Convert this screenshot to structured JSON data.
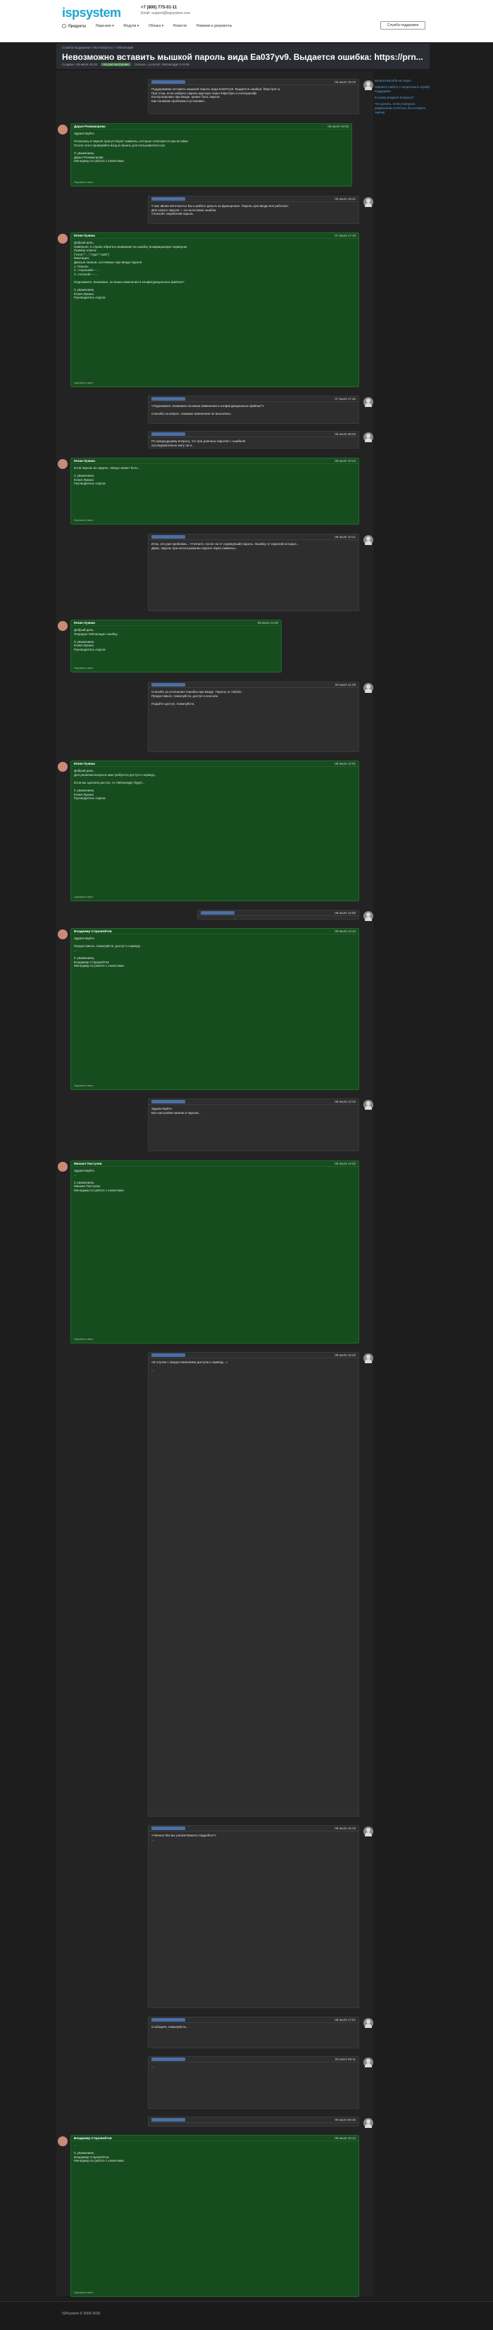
{
  "header": {
    "logo": "ispsystem",
    "phone": "+7 (800) 775-01-11",
    "support_email": "Email: support@ispsystem.com",
    "help_button": "Служба поддержки",
    "nav": [
      "Продукты",
      "Лицензии ▾",
      "Модули ▾",
      "Облака ▾",
      "Новости",
      "Новинки и документы"
    ]
  },
  "breadcrumb": "Служба поддержки > Все вопросы > VMmanager",
  "topic": {
    "title": "Невозможно вставить мышкой пароль вида Ea037yv9. Выдается ошибка: https://prn...",
    "created": "Создано: 06 июля 18:19",
    "status": "На рассмотрении",
    "meta_tail": "Связан с услугой: VMmanager 5 KVM"
  },
  "sidebar": {
    "items": [
      "Вопрос/жалоба на отдел",
      "Оцените работу с вопросом в службу поддержки",
      "В каком разделе вопроса?",
      "Что делать, если у вопроса разрешение хотелось бы оставить оценку"
    ]
  },
  "posts": [
    {
      "kind": "user",
      "name": "",
      "date": "06 июля 18:19",
      "body": "Поддерживаю вставить мышкой пароль вида Ea037yv9. Выдается ошибка: https://prn.a\nПри этом, если набрать пароль вручную через https://prn.a.ru/vmpaneljk\nКонтролировал при вводе, может быть пароль\nКак понимаю проблема в установке...",
      "foot": ""
    },
    {
      "kind": "staff",
      "name": "Дарья Рохмакорова",
      "date": "06 июля 19:03",
      "body": "Здравствуйте.\n\nПоскольку в пароле присутствуют символы, которые отличаются при вставке.\nПосле этого проверяйте вход в панель для пользователя root.\n\nС уважением,\nДарья Рохмакорова\nМенеджер по работе с клиентами",
      "foot": "Оцените ответ"
    },
    {
      "kind": "user",
      "name": "",
      "date": "06 июля 19:42",
      "body": "У вас явная неточность! Вы и работе деньги за функционал. Пароль при вводе всё работает.\nДля нового пароля — из-за вставки ошибка.\n«плохой» нерабочий пароль",
      "foot": ""
    },
    {
      "kind": "staff",
      "name": "Юлия Лукина",
      "date": "07 июля 17:19",
      "body": "Добрый день.\nНаверное, в строке обратить внимание на ошибку возвращаемую сервером.\nПример ответа:\n{\"error\":\"...\",\"type\":\"auth\"}\nИмитация.\nДанные панели, системные при вводе пароля\n1. Панель\n2. «хороший» – ...\n3. «плохой» – ...\n\nПодскажите, возможно, ли ваши изменения в конфигурационных файлах?\n\nС уважением,\nЮлия Лукина\nРуководитель отдела",
      "foot": "Оцените ответ"
    },
    {
      "kind": "user",
      "name": "",
      "date": "07 июля 17:45",
      "body": "«Подскажите, возможно ли ваши изменения в конфигурационных файлах?»\n\nСпасибо за вопрос. Никакие изменения не вносились.",
      "foot": ""
    },
    {
      "kind": "user",
      "name": "",
      "date": "08 июля 08:03",
      "body": "По предыдущему вопросу, что при длинных паролях с ошибкой\nпоследовательно могу ли я...",
      "foot": ""
    },
    {
      "kind": "staff",
      "name": "Юлия Лукина",
      "date": "08 июля 10:23",
      "body": "Если пароль из задачи, «ввод» может быть... \n\nС уважением,\nЮлия Лукина\nРуководитель отдела",
      "foot": "Оцените ответ"
    },
    {
      "kind": "user",
      "name": "",
      "date": "08 июля 10:41",
      "body": "Итак, это уже проблема... Уточните, после ли от сервер(ный) пароль. Ошибку от паролей которые...\nДаже, пароль при использовании пароля через символы...",
      "foot": ""
    },
    {
      "kind": "staff",
      "name": "Юлия Лукина",
      "date": "08 июля 11:06",
      "body": "Добрый день.\nПередаю VMmanager ошибку.\n\nС уважением,\nЮлия Лукина\nРуководитель отдела",
      "foot": "Оцените ответ"
    },
    {
      "kind": "user",
      "name": "",
      "date": "08 июля 11:39",
      "body": "Спасибо за уточнение! Ошибка при вводе. Пароль от любой...\nПредоставьте, пожалуйста, доступ к консоли.\n\nПодайте доступ, пожалуйста.",
      "foot": ""
    },
    {
      "kind": "staff",
      "name": "Юлия Лукина",
      "date": "08 июля 12:01",
      "body": "Добрый день.\nДля решения вопроса нам требуется доступ к серверу...\n\nЕсли вы сделали доступ, то VMmanager будет...\n\nС уважением,\nЮлия Лукина\nРуководитель отдела",
      "foot": "Оцените ответ"
    },
    {
      "kind": "user",
      "name": "",
      "date": "08 июля 12:55",
      "body": "Дополнительно, спасибо! Подождите",
      "foot": ""
    },
    {
      "kind": "staff",
      "name": "Владимир Старовойтов",
      "date": "08 июля 13:10",
      "body": "Здравствуйте.\n\nПредоставьте, пожалуйста, доступ к серверу.\n...\n\nС уважением,\nВладимир Старовойтов\nМенеджер по работе с клиентами",
      "foot": "Оцените ответ"
    },
    {
      "kind": "user",
      "name": "",
      "date": "08 июля 13:49",
      "body": "Здравствуйте.\nВсе настройки панели и пароли...",
      "foot": ""
    },
    {
      "kind": "staff",
      "name": "Михаил Пастухов",
      "date": "08 июля 14:32",
      "body": "Здравствуйте.\n...\n\nС уважением,\nМихаил Пастухов\nМенеджер по работе с клиентами",
      "foot": "Оцените ответ"
    },
    {
      "kind": "user",
      "name": "",
      "date": "08 июля 15:40",
      "body": "«В случае с предоставлением доступа к серверу...»\n\n...",
      "foot": ""
    },
    {
      "kind": "user",
      "name": "",
      "date": "08 июля 16:10",
      "body": "«Начало без вы узнали Вашего подробно?»\n...",
      "foot": ""
    },
    {
      "kind": "user",
      "name": "",
      "date": "08 июля 17:01",
      "body": "Сообщите, пожалуйста...",
      "foot": ""
    },
    {
      "kind": "user",
      "name": "",
      "date": "09 июля 09:11",
      "body": "...",
      "foot": ""
    },
    {
      "kind": "user",
      "name": "",
      "date": "09 июля 09:40",
      "body": "...",
      "foot": ""
    },
    {
      "kind": "staff",
      "name": "Владимир Старовойтов",
      "date": "09 июля 10:12",
      "body": "...\n\nС уважением,\nВладимир Старовойтов\nМенеджер по работе с клиентами",
      "foot": "Оцените ответ"
    },
    {
      "kind": "user",
      "name": "",
      "date": "09 июля 11:30",
      "body": "...",
      "foot": ""
    },
    {
      "kind": "user",
      "name": "",
      "date": "09 июля 12:02",
      "body": "...",
      "foot": ""
    }
  ],
  "footer": "ISPsystem © 2004-2020"
}
